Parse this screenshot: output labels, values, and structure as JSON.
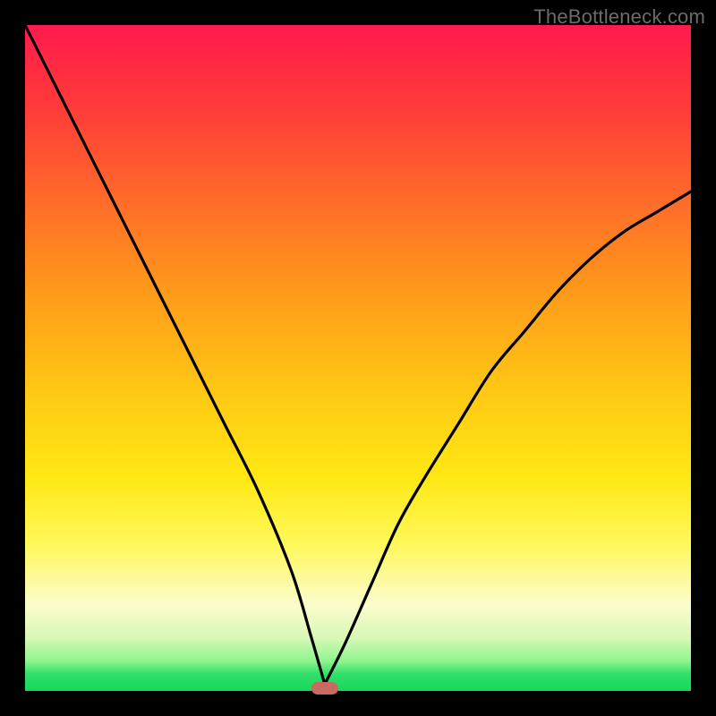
{
  "watermark": "TheBottleneck.com",
  "colors": {
    "background": "#000000",
    "curve": "#000000",
    "marker": "#c96a61",
    "gradient_top": "#ff1a4d",
    "gradient_bottom": "#16d85a"
  },
  "chart_data": {
    "type": "line",
    "title": "",
    "xlabel": "",
    "ylabel": "",
    "xlim": [
      0,
      100
    ],
    "ylim": [
      0,
      100
    ],
    "grid": false,
    "legend": false,
    "annotations": [
      "TheBottleneck.com"
    ],
    "minimum_x": 45,
    "marker": {
      "x": 45,
      "y": 0.5,
      "color": "#c96a61"
    },
    "series": [
      {
        "name": "left-branch",
        "x": [
          0,
          5,
          10,
          15,
          20,
          25,
          30,
          35,
          40,
          43,
          45
        ],
        "values": [
          100,
          90,
          80,
          70,
          60,
          50,
          40,
          30,
          18,
          8,
          1
        ]
      },
      {
        "name": "right-branch",
        "x": [
          45,
          48,
          52,
          56,
          60,
          65,
          70,
          75,
          80,
          85,
          90,
          95,
          100
        ],
        "values": [
          1,
          7,
          16,
          25,
          32,
          40,
          48,
          54,
          60,
          65,
          69,
          72,
          75
        ]
      }
    ]
  }
}
